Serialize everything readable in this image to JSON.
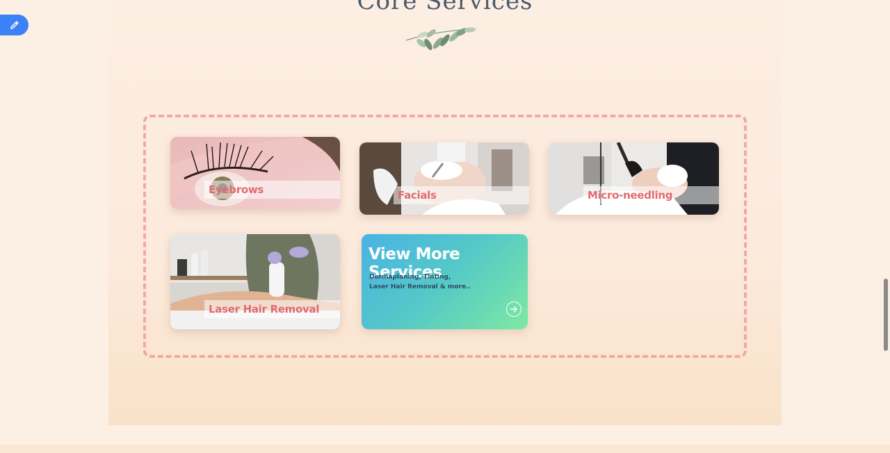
{
  "section": {
    "title": "Core Services",
    "leaf_icon": "olive-branch-icon"
  },
  "edit_button": {
    "icon": "pencil-icon"
  },
  "services": [
    {
      "label": "Eyebrows",
      "photo": "eye-lashes-photo"
    },
    {
      "label": "Facials",
      "photo": "facial-treatment-photo"
    },
    {
      "label": "Micro-needling",
      "photo": "microneedling-photo"
    },
    {
      "label": "Laser Hair Removal",
      "photo": "laser-hair-removal-photo"
    }
  ],
  "more_card": {
    "title": "View More Services",
    "desc_line1": "Dermaplaning, Tinting,",
    "desc_line2": "Laser Hair Removal & more..",
    "icon": "arrow-right-circle-icon"
  },
  "colors": {
    "label": "#e26a6d",
    "dash": "#f0a9a6",
    "title": "#4a5a6c",
    "fab": "#3b82f6"
  }
}
